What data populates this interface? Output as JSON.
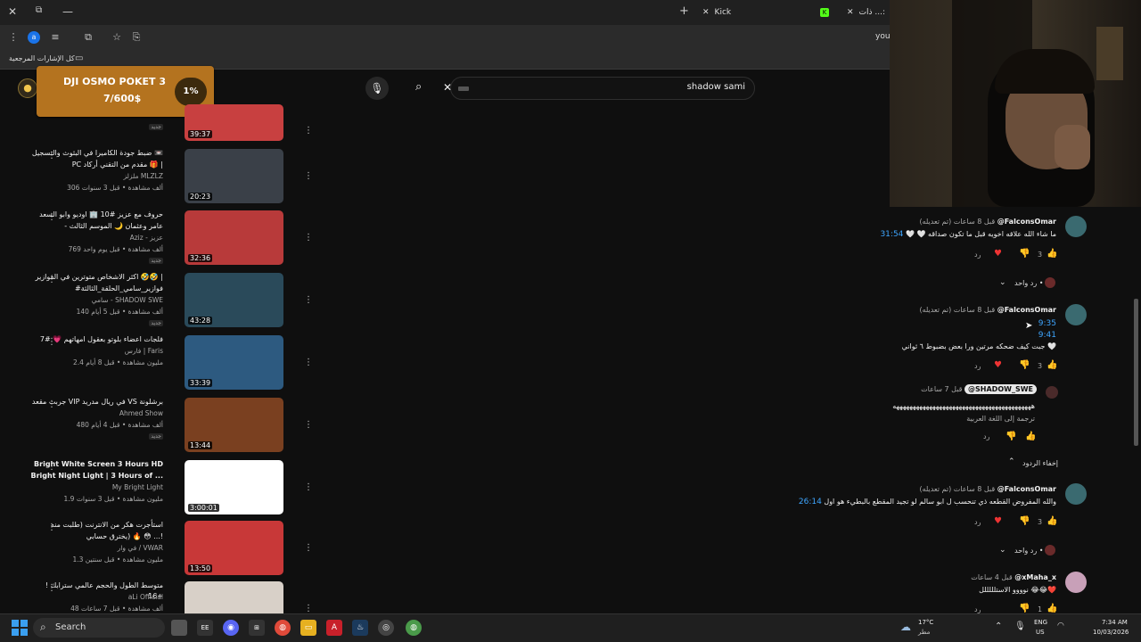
{
  "browser": {
    "tabs": [
      {
        "label": "Kick",
        "icon": "kick-icon"
      },
      {
        "label": "ذات ...:",
        "icon": "kick-icon"
      }
    ],
    "window_controls": {
      "close": "✕",
      "maximize": "⧉",
      "minimize": "—"
    },
    "new_tab": "+",
    "url_partial": "yout",
    "bookmarks": {
      "folder_label": "كل الإشارات المرجعية"
    }
  },
  "youtube": {
    "search": {
      "query": "shadow sami"
    }
  },
  "overlay": {
    "title": "DJI OSMO POKET 3",
    "progress_text": "7/600$",
    "percent": "1%"
  },
  "videos": [
    {
      "duration": "39:37",
      "title1": "",
      "title2": "",
      "channel": "",
      "meta": "",
      "badge": "جديد",
      "thumb": "#c84040"
    },
    {
      "duration": "20:23",
      "title1": "ضبط جودة الكاميرا في البثوث والتسجيل 📼",
      "title2": "PC مقدم من التقني أركاد 🎁 |",
      "channel": "ملزلز MLZLZ",
      "meta": "306 ألف مشاهدة • قبل 3 سنوات",
      "badge": "",
      "thumb": "#3a4048"
    },
    {
      "duration": "32:36",
      "title1": "حروف مع عزيز #10 🏢 اوديو وابو السعد",
      "title2": "- عامر وعثمان 🌙 الموسم الثالث",
      "channel": "Aziz - عزيز",
      "meta": "769 ألف مشاهدة • قبل يوم واحد",
      "badge": "جديد",
      "thumb": "#b83a3a"
    },
    {
      "duration": "43:28",
      "title1": "اكثر الاشخاص متوترين في الفوازير 🤣🤣 |",
      "title2": "#فوازير_سامي_الحلقة_الثالثة",
      "channel": "سامي - SHADOW SWE",
      "meta": "140 ألف مشاهدة • قبل 5 أيام",
      "badge": "جديد",
      "thumb": "#2a4a5a"
    },
    {
      "duration": "33:39",
      "title1": "فلجات اعضاء بلوتو بعقول امهاتهم 💗 #7",
      "title2": "",
      "channel": "فارس | Faris",
      "meta": "2.4 مليون مشاهدة • قبل 8 أيام",
      "badge": "",
      "thumb": "#2d5a80"
    },
    {
      "duration": "13:44",
      "title1": "جربت مقعد VIP في ريال مدريد VS برشلونة",
      "title2": "",
      "channel": "Ahmed Show",
      "meta": "480 ألف مشاهدة • قبل 4 أيام",
      "badge": "جديد",
      "thumb": "#7a4020"
    },
    {
      "duration": "3:00:01",
      "title1": "Bright White Screen 3 Hours HD",
      "title2": "Bright Night Light | 3 Hours of ...",
      "channel": "My Bright Light",
      "meta": "1.9 مليون مشاهدة • قبل 3 سنوات",
      "badge": "",
      "thumb": "#ffffff"
    },
    {
      "duration": "13:50",
      "title1": "استأجرت هكر من الانترنت (طلبت منه",
      "title2": "يخترق حسابي) 🔥 😳 ...!",
      "channel": "في وار / VWAR",
      "meta": "1.3 مليون مشاهدة • قبل سنتين",
      "badge": "",
      "thumb": "#c83838"
    },
    {
      "duration": "",
      "title1": "متوسط الطول والحجم عالمي سترابك ! 16+",
      "title2": "",
      "channel": "aLi Official",
      "meta": "48 ألف مشاهدة • قبل 7 ساعات",
      "badge": "",
      "thumb": "#d8d0c8"
    }
  ],
  "comments": [
    {
      "user": "@FalconsOmar",
      "time": "قبل 8 ساعات (تم تعديله)",
      "timestamp": "31:54",
      "text": "ما شاء الله علاقه اخويه قبل ما تكون صداقه 🤍 🤍",
      "likes": "3",
      "replies": "رد واحد •",
      "reply_label": "رد",
      "avatar": "#3a6a70"
    },
    {
      "user": "@FalconsOmar",
      "time": "قبل 8 ساعات (تم تعديله)",
      "timestamp": "9:35",
      "timestamp2": "9:41",
      "text": "جبت كيف ضحكه مرتين ورا بعض بضبوط ٦ ثواني 🤍",
      "likes": "3",
      "reply_label": "رد",
      "avatar": "#3a6a70"
    },
    {
      "user": "@SHADOW_SWE",
      "time": "قبل 7 ساعات",
      "text": "ههههههههههههههههههههههههههههههههههههههههههه",
      "translate": "ترجمة إلى اللغة العربية",
      "reply_label": "رد",
      "hide": "إخفاء الردود",
      "avatar": "#4a2a2a"
    },
    {
      "user": "@FalconsOmar",
      "time": "قبل 8 ساعات (تم تعديله)",
      "timestamp": "26:14",
      "text": "والله المفروض القطعه ذي تنحسب ل ابو سالم لو تجيد المقطع بالبطيء هو اول",
      "likes": "3",
      "replies": "رد واحد •",
      "reply_label": "رد",
      "avatar": "#3a6a70"
    },
    {
      "user": "@xMaha_x",
      "time": "قبل 4 ساعات",
      "text": "نوووو الاستلللللل 😂😂❤️",
      "likes": "1",
      "reply_label": "رد",
      "avatar": "#c8a0b8"
    }
  ],
  "taskbar": {
    "search_label": "Search",
    "weather_temp": "17°C",
    "weather_desc": "مطر",
    "lang_line1": "ENG",
    "lang_line2": "US",
    "time": "7:34 AM",
    "date": "10/03/2026"
  }
}
